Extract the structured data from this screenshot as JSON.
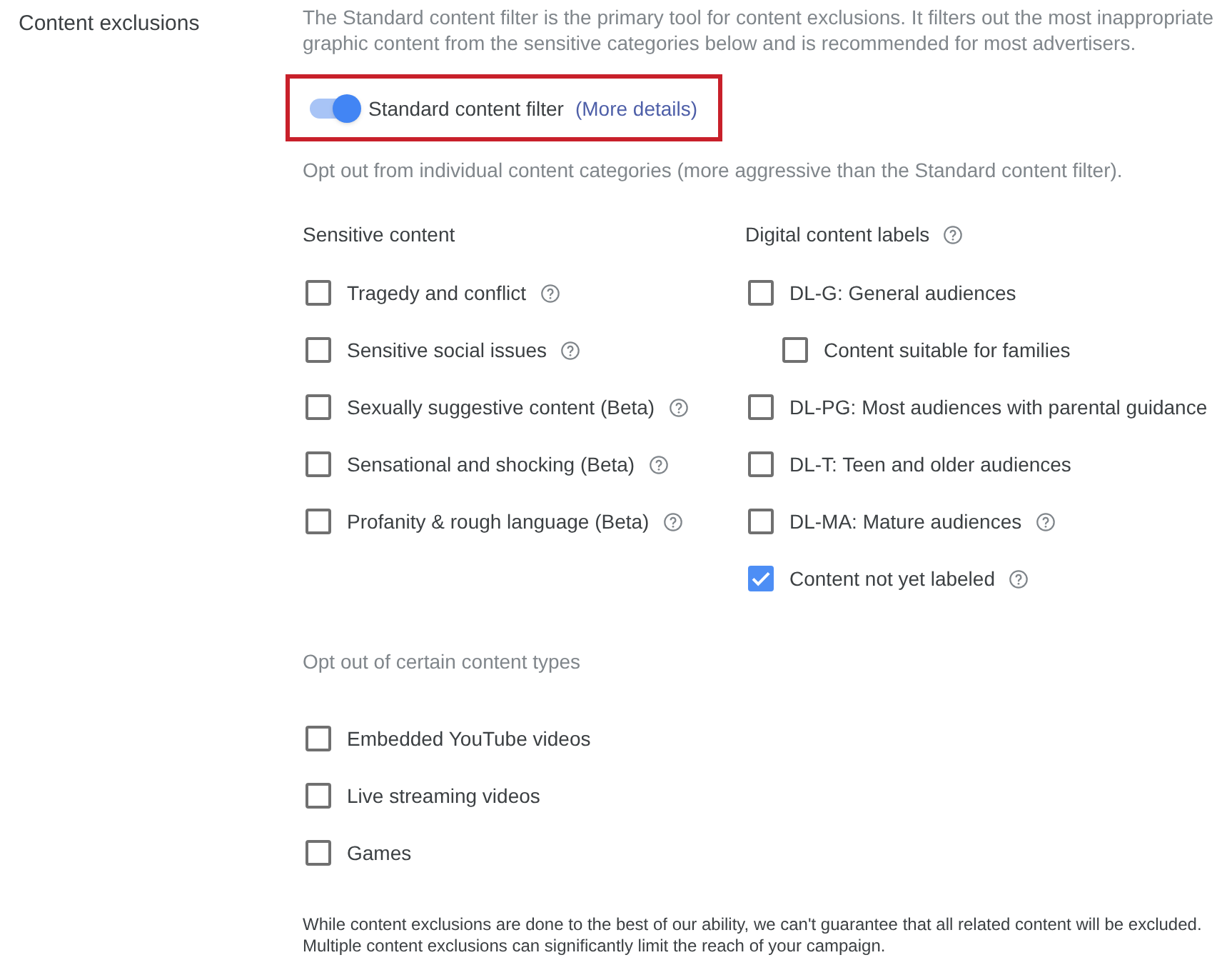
{
  "section": {
    "label": "Content exclusions"
  },
  "description_lines": [
    "The Standard content filter is the primary tool for content exclusions. It filters out the most inappropriate",
    "graphic content from the sensitive categories below and is recommended for most advertisers."
  ],
  "standard_filter": {
    "on": true,
    "label": "Standard content filter",
    "link": "(More details)",
    "highlighted": true
  },
  "opt_out_note": "Opt out from individual content categories (more aggressive than the Standard content filter).",
  "sensitive_content": {
    "title": "Sensitive content",
    "items": [
      {
        "label": "Tragedy and conflict",
        "checked": false,
        "help": true
      },
      {
        "label": "Sensitive social issues",
        "checked": false,
        "help": true
      },
      {
        "label": "Sexually suggestive content (Beta)",
        "checked": false,
        "help": true
      },
      {
        "label": "Sensational and shocking (Beta)",
        "checked": false,
        "help": true
      },
      {
        "label": "Profanity & rough language (Beta)",
        "checked": false,
        "help": true
      }
    ]
  },
  "digital_content_labels": {
    "title": "Digital content labels",
    "help": true,
    "items": [
      {
        "label": "DL-G: General audiences",
        "checked": false,
        "help": false,
        "children": [
          {
            "label": "Content suitable for families",
            "checked": false,
            "help": false
          }
        ]
      },
      {
        "label": "DL-PG: Most audiences with parental guidance",
        "checked": false,
        "help": false
      },
      {
        "label": "DL-T: Teen and older audiences",
        "checked": false,
        "help": false
      },
      {
        "label": "DL-MA: Mature audiences",
        "checked": false,
        "help": true
      },
      {
        "label": "Content not yet labeled",
        "checked": true,
        "help": true
      }
    ]
  },
  "content_types": {
    "title": "Opt out of certain content types",
    "items": [
      {
        "label": "Embedded YouTube videos",
        "checked": false,
        "help": false
      },
      {
        "label": "Live streaming videos",
        "checked": false,
        "help": false
      },
      {
        "label": "Games",
        "checked": false,
        "help": false
      }
    ]
  },
  "footer_lines": [
    "While content exclusions are done to the best of our ability, we can't guarantee that all related content will be excluded.",
    "Multiple content exclusions can significantly limit the reach of your campaign."
  ]
}
